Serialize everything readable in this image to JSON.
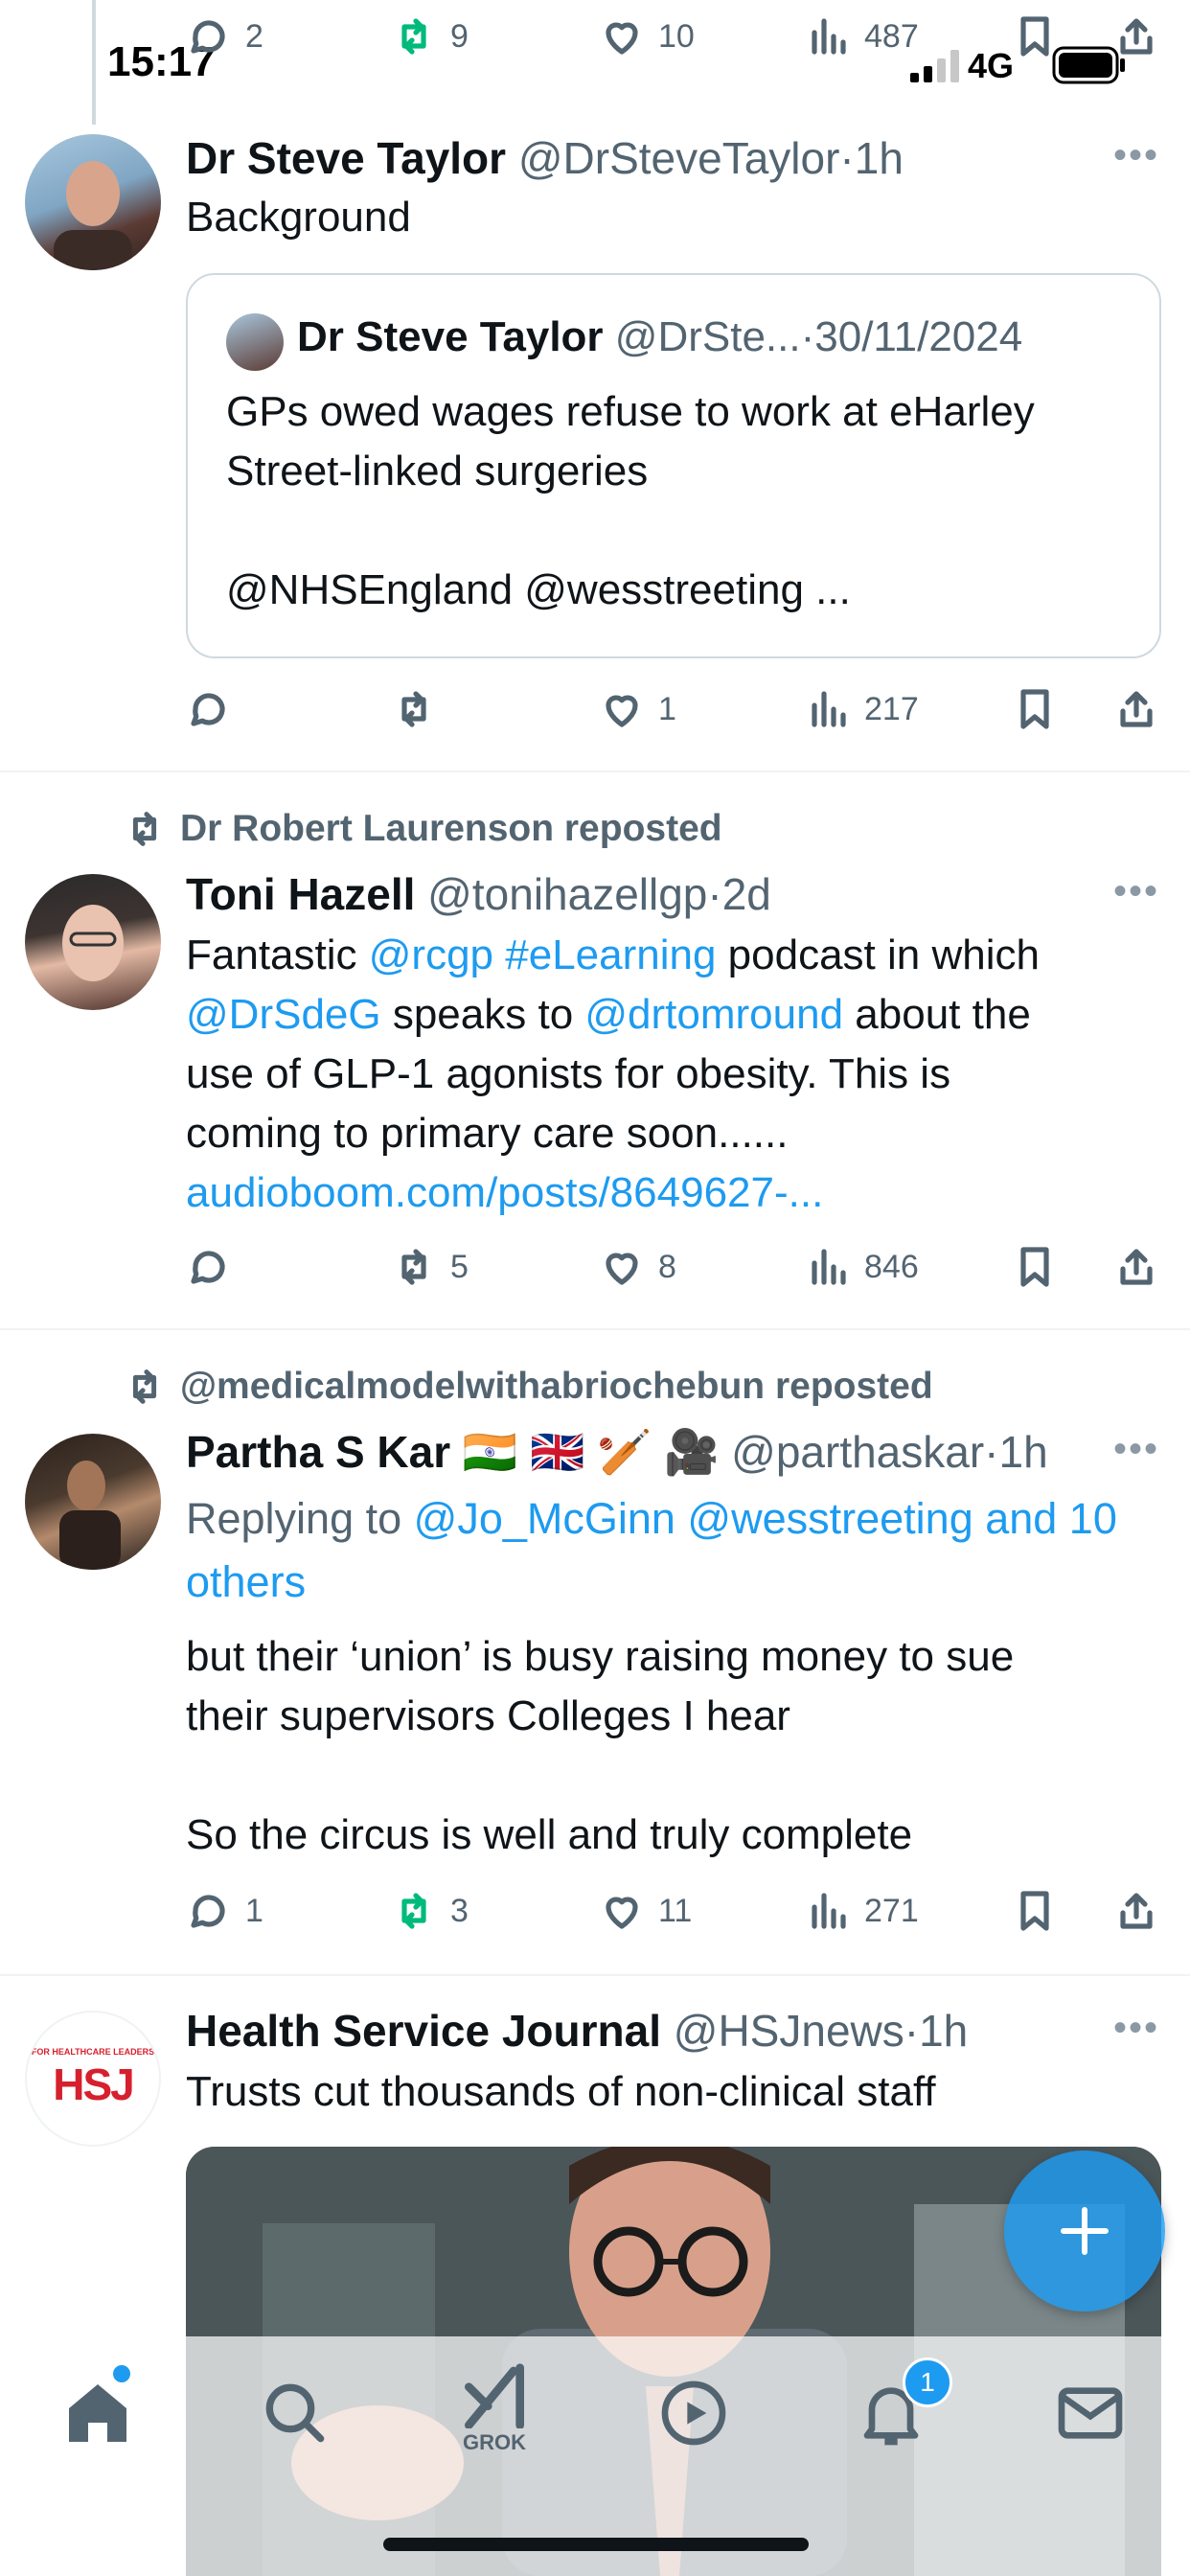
{
  "status_bar": {
    "time": "15:17",
    "network": "4G"
  },
  "top_actions": {
    "replies": "2",
    "reposts": "9",
    "likes": "10",
    "views": "487"
  },
  "tweets": [
    {
      "name": "Dr Steve Taylor",
      "handle": "@DrSteveTaylor",
      "time": "1h",
      "text": "Background",
      "quote": {
        "name": "Dr Steve Taylor",
        "handle": "@DrSte...",
        "date": "30/11/2024",
        "line1": "GPs owed wages refuse to work at eHarley",
        "line2": "Street-linked surgeries",
        "line3": "@NHSEngland @wesstreeting ..."
      },
      "actions": {
        "replies": "",
        "reposts": "",
        "likes": "1",
        "views": "217"
      }
    },
    {
      "reposted_by": "Dr Robert Laurenson reposted",
      "name": "Toni Hazell",
      "handle": "@tonihazellgp",
      "time": "2d",
      "text_parts": {
        "t1": "Fantastic ",
        "m1": "@rcgp",
        "m2": "#eLearning",
        "t2": " podcast in which",
        "m3": "@DrSdeG",
        "t3": " speaks to ",
        "m4": "@drtomround",
        "t4": " about the",
        "t5": "use of GLP-1 agonists for obesity. This is",
        "t6": "coming to primary care soon......",
        "link": "audioboom.com/posts/8649627-..."
      },
      "actions": {
        "replies": "",
        "reposts": "5",
        "likes": "8",
        "views": "846"
      }
    },
    {
      "reposted_by": "@medicalmodelwithabriochebun reposted",
      "name": "Partha S Kar",
      "emoji": "🇮🇳 🇬🇧 🏏 🎥",
      "handle": "@parthaskar",
      "time": "1h",
      "replying_label": "Replying to ",
      "replying_to": "@Jo_McGinn @wesstreeting and 10",
      "replying_to2": "others",
      "line1": "but their ‘union’ is busy raising money to sue",
      "line2": "their supervisors Colleges I hear",
      "line3": "So the circus is well and truly complete",
      "actions": {
        "replies": "1",
        "reposts": "3",
        "likes": "11",
        "views": "271"
      }
    },
    {
      "name": "Health Service Journal",
      "handle": "@HSJnews",
      "time": "1h",
      "text": "Trusts cut thousands of non-clinical staff",
      "avatar_text": "HSJ",
      "avatar_caption": "FOR HEALTHCARE LEADERS"
    }
  ],
  "nav": {
    "grok_label": "GROK",
    "notification_count": "1"
  },
  "colors": {
    "accent": "#1d9bf0",
    "repost_green": "#00ba7c",
    "muted": "#536471"
  }
}
